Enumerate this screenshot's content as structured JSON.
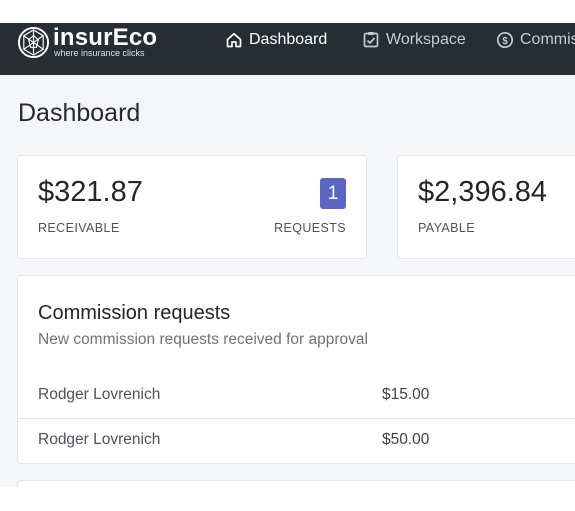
{
  "brand": {
    "name": "insurEco",
    "tagline": "where insurance clicks"
  },
  "nav": {
    "items": [
      {
        "label": "Dashboard",
        "icon": "home-icon",
        "active": true
      },
      {
        "label": "Workspace",
        "icon": "clipboard-check-icon",
        "active": false
      },
      {
        "label": "Commis",
        "icon": "dollar-circle-icon",
        "active": false
      }
    ]
  },
  "page": {
    "title": "Dashboard"
  },
  "stats": {
    "receivable": {
      "value": "$321.87",
      "label": "RECEIVABLE"
    },
    "requests": {
      "count": "1",
      "label": "REQUESTS"
    },
    "payable": {
      "value": "$2,396.84",
      "label": "PAYABLE"
    }
  },
  "commission_requests": {
    "title": "Commission requests",
    "subtitle": "New commission requests received for approval",
    "rows": [
      {
        "name": "Rodger Lovrenich",
        "amount": "$15.00"
      },
      {
        "name": "Rodger Lovrenich",
        "amount": "$50.00"
      }
    ]
  },
  "colors": {
    "navbar_bg": "#262d33",
    "badge_bg": "#5b66c4",
    "page_bg": "#f5f6f8"
  }
}
